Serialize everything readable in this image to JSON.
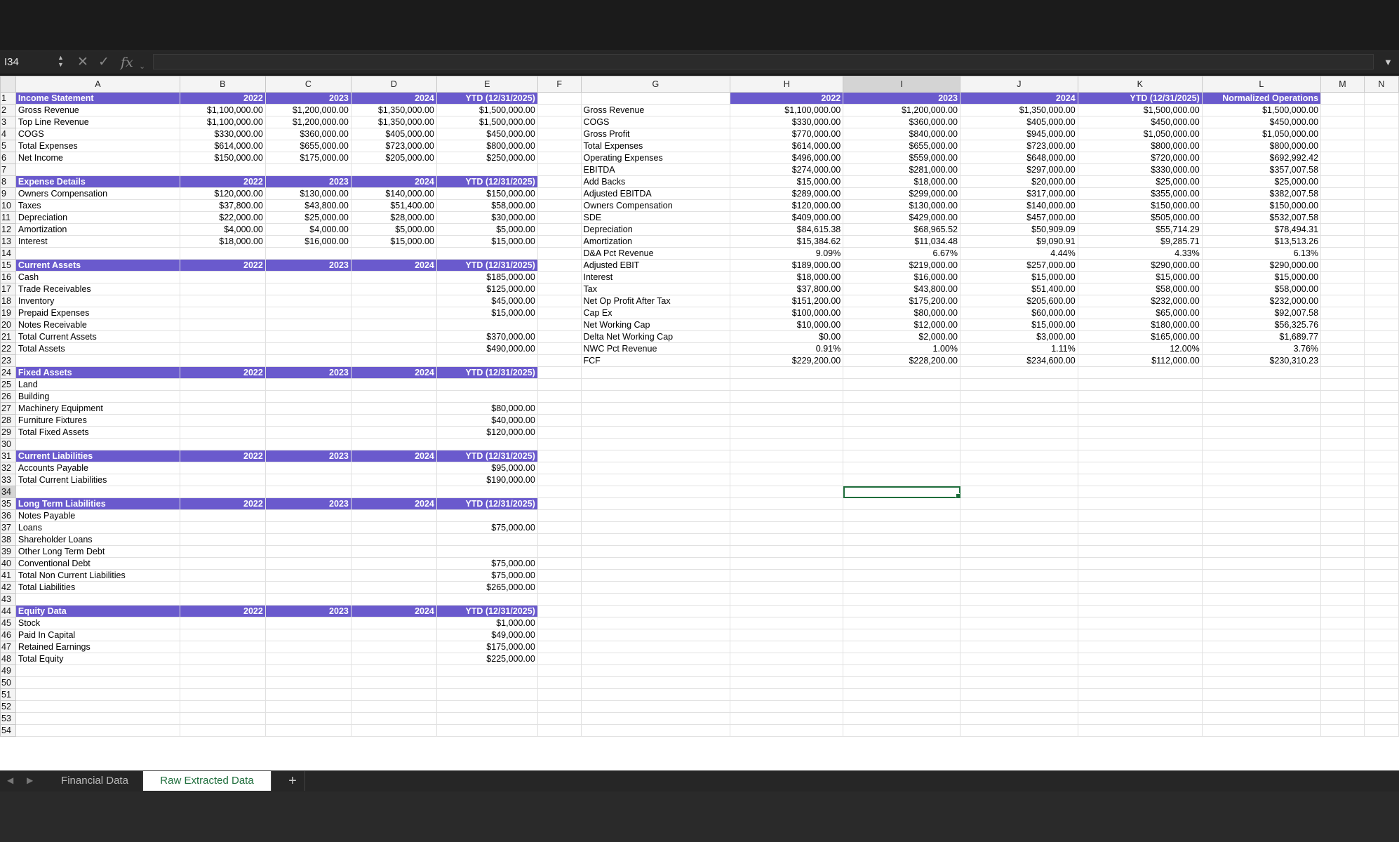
{
  "formula_bar": {
    "name_box": "I34",
    "formula": ""
  },
  "columns": [
    "",
    "A",
    "B",
    "C",
    "D",
    "E",
    "F",
    "G",
    "H",
    "I",
    "J",
    "K",
    "L",
    "M",
    "N"
  ],
  "selected_cell": {
    "row": 34,
    "col": "I"
  },
  "header_rows": [
    1,
    8,
    15,
    24,
    31,
    35,
    44
  ],
  "rows": [
    {
      "n": 1,
      "A": "Income Statement",
      "B": "2022",
      "C": "2023",
      "D": "2024",
      "E": "YTD (12/31/2025)",
      "G": "",
      "H": "2022",
      "I": "2023",
      "J": "2024",
      "K": "YTD (12/31/2025)",
      "L": "Normalized Operations"
    },
    {
      "n": 2,
      "A": "Gross Revenue",
      "B": "$1,100,000.00",
      "C": "$1,200,000.00",
      "D": "$1,350,000.00",
      "E": "$1,500,000.00",
      "G": "Gross Revenue",
      "H": "$1,100,000.00",
      "I": "$1,200,000.00",
      "J": "$1,350,000.00",
      "K": "$1,500,000.00",
      "L": "$1,500,000.00"
    },
    {
      "n": 3,
      "A": "Top Line Revenue",
      "B": "$1,100,000.00",
      "C": "$1,200,000.00",
      "D": "$1,350,000.00",
      "E": "$1,500,000.00",
      "G": "COGS",
      "H": "$330,000.00",
      "I": "$360,000.00",
      "J": "$405,000.00",
      "K": "$450,000.00",
      "L": "$450,000.00"
    },
    {
      "n": 4,
      "A": "COGS",
      "B": "$330,000.00",
      "C": "$360,000.00",
      "D": "$405,000.00",
      "E": "$450,000.00",
      "G": "Gross Profit",
      "H": "$770,000.00",
      "I": "$840,000.00",
      "J": "$945,000.00",
      "K": "$1,050,000.00",
      "L": "$1,050,000.00"
    },
    {
      "n": 5,
      "A": "Total Expenses",
      "B": "$614,000.00",
      "C": "$655,000.00",
      "D": "$723,000.00",
      "E": "$800,000.00",
      "G": "Total Expenses",
      "H": "$614,000.00",
      "I": "$655,000.00",
      "J": "$723,000.00",
      "K": "$800,000.00",
      "L": "$800,000.00"
    },
    {
      "n": 6,
      "A": "Net Income",
      "B": "$150,000.00",
      "C": "$175,000.00",
      "D": "$205,000.00",
      "E": "$250,000.00",
      "G": "Operating Expenses",
      "H": "$496,000.00",
      "I": "$559,000.00",
      "J": "$648,000.00",
      "K": "$720,000.00",
      "L": "$692,992.42"
    },
    {
      "n": 7,
      "G": "EBITDA",
      "H": "$274,000.00",
      "I": "$281,000.00",
      "J": "$297,000.00",
      "K": "$330,000.00",
      "L": "$357,007.58"
    },
    {
      "n": 8,
      "A": "Expense Details",
      "B": "2022",
      "C": "2023",
      "D": "2024",
      "E": "YTD (12/31/2025)",
      "G": "Add Backs",
      "H": "$15,000.00",
      "I": "$18,000.00",
      "J": "$20,000.00",
      "K": "$25,000.00",
      "L": "$25,000.00"
    },
    {
      "n": 9,
      "A": "Owners Compensation",
      "B": "$120,000.00",
      "C": "$130,000.00",
      "D": "$140,000.00",
      "E": "$150,000.00",
      "G": "Adjusted EBITDA",
      "H": "$289,000.00",
      "I": "$299,000.00",
      "J": "$317,000.00",
      "K": "$355,000.00",
      "L": "$382,007.58"
    },
    {
      "n": 10,
      "A": "Taxes",
      "B": "$37,800.00",
      "C": "$43,800.00",
      "D": "$51,400.00",
      "E": "$58,000.00",
      "G": "Owners Compensation",
      "H": "$120,000.00",
      "I": "$130,000.00",
      "J": "$140,000.00",
      "K": "$150,000.00",
      "L": "$150,000.00"
    },
    {
      "n": 11,
      "A": "Depreciation",
      "B": "$22,000.00",
      "C": "$25,000.00",
      "D": "$28,000.00",
      "E": "$30,000.00",
      "G": "SDE",
      "H": "$409,000.00",
      "I": "$429,000.00",
      "J": "$457,000.00",
      "K": "$505,000.00",
      "L": "$532,007.58"
    },
    {
      "n": 12,
      "A": "Amortization",
      "B": "$4,000.00",
      "C": "$4,000.00",
      "D": "$5,000.00",
      "E": "$5,000.00",
      "G": "Depreciation",
      "H": "$84,615.38",
      "I": "$68,965.52",
      "J": "$50,909.09",
      "K": "$55,714.29",
      "L": "$78,494.31"
    },
    {
      "n": 13,
      "A": "Interest",
      "B": "$18,000.00",
      "C": "$16,000.00",
      "D": "$15,000.00",
      "E": "$15,000.00",
      "G": "Amortization",
      "H": "$15,384.62",
      "I": "$11,034.48",
      "J": "$9,090.91",
      "K": "$9,285.71",
      "L": "$13,513.26"
    },
    {
      "n": 14,
      "G": "D&A Pct Revenue",
      "H": "9.09%",
      "I": "6.67%",
      "J": "4.44%",
      "K": "4.33%",
      "L": "6.13%"
    },
    {
      "n": 15,
      "A": "Current Assets",
      "B": "2022",
      "C": "2023",
      "D": "2024",
      "E": "YTD (12/31/2025)",
      "G": "Adjusted EBIT",
      "H": "$189,000.00",
      "I": "$219,000.00",
      "J": "$257,000.00",
      "K": "$290,000.00",
      "L": "$290,000.00"
    },
    {
      "n": 16,
      "A": "Cash",
      "E": "$185,000.00",
      "G": "Interest",
      "H": "$18,000.00",
      "I": "$16,000.00",
      "J": "$15,000.00",
      "K": "$15,000.00",
      "L": "$15,000.00"
    },
    {
      "n": 17,
      "A": "Trade Receivables",
      "E": "$125,000.00",
      "G": "Tax",
      "H": "$37,800.00",
      "I": "$43,800.00",
      "J": "$51,400.00",
      "K": "$58,000.00",
      "L": "$58,000.00"
    },
    {
      "n": 18,
      "A": "Inventory",
      "E": "$45,000.00",
      "G": "Net Op Profit After Tax",
      "H": "$151,200.00",
      "I": "$175,200.00",
      "J": "$205,600.00",
      "K": "$232,000.00",
      "L": "$232,000.00"
    },
    {
      "n": 19,
      "A": "Prepaid Expenses",
      "E": "$15,000.00",
      "G": "Cap Ex",
      "H": "$100,000.00",
      "I": "$80,000.00",
      "J": "$60,000.00",
      "K": "$65,000.00",
      "L": "$92,007.58"
    },
    {
      "n": 20,
      "A": "Notes Receivable",
      "G": "Net Working Cap",
      "H": "$10,000.00",
      "I": "$12,000.00",
      "J": "$15,000.00",
      "K": "$180,000.00",
      "L": "$56,325.76"
    },
    {
      "n": 21,
      "A": "Total Current Assets",
      "E": "$370,000.00",
      "G": "Delta Net Working Cap",
      "H": "$0.00",
      "I": "$2,000.00",
      "J": "$3,000.00",
      "K": "$165,000.00",
      "L": "$1,689.77"
    },
    {
      "n": 22,
      "A": "Total Assets",
      "E": "$490,000.00",
      "G": "NWC Pct Revenue",
      "H": "0.91%",
      "I": "1.00%",
      "J": "1.11%",
      "K": "12.00%",
      "L": "3.76%"
    },
    {
      "n": 23,
      "G": "FCF",
      "H": "$229,200.00",
      "I": "$228,200.00",
      "J": "$234,600.00",
      "K": "$112,000.00",
      "L": "$230,310.23"
    },
    {
      "n": 24,
      "A": "Fixed Assets",
      "B": "2022",
      "C": "2023",
      "D": "2024",
      "E": "YTD (12/31/2025)"
    },
    {
      "n": 25,
      "A": "Land"
    },
    {
      "n": 26,
      "A": "Building"
    },
    {
      "n": 27,
      "A": "Machinery Equipment",
      "E": "$80,000.00"
    },
    {
      "n": 28,
      "A": "Furniture Fixtures",
      "E": "$40,000.00"
    },
    {
      "n": 29,
      "A": "Total Fixed Assets",
      "E": "$120,000.00"
    },
    {
      "n": 30
    },
    {
      "n": 31,
      "A": "Current Liabilities",
      "B": "2022",
      "C": "2023",
      "D": "2024",
      "E": "YTD (12/31/2025)"
    },
    {
      "n": 32,
      "A": "Accounts Payable",
      "E": "$95,000.00"
    },
    {
      "n": 33,
      "A": "Total Current Liabilities",
      "E": "$190,000.00"
    },
    {
      "n": 34
    },
    {
      "n": 35,
      "A": "Long Term Liabilities",
      "B": "2022",
      "C": "2023",
      "D": "2024",
      "E": "YTD (12/31/2025)"
    },
    {
      "n": 36,
      "A": "Notes Payable"
    },
    {
      "n": 37,
      "A": "Loans",
      "E": "$75,000.00"
    },
    {
      "n": 38,
      "A": "Shareholder Loans"
    },
    {
      "n": 39,
      "A": "Other Long Term Debt"
    },
    {
      "n": 40,
      "A": "Conventional Debt",
      "E": "$75,000.00"
    },
    {
      "n": 41,
      "A": "Total Non Current Liabilities",
      "E": "$75,000.00"
    },
    {
      "n": 42,
      "A": "Total Liabilities",
      "E": "$265,000.00"
    },
    {
      "n": 43
    },
    {
      "n": 44,
      "A": "Equity Data",
      "B": "2022",
      "C": "2023",
      "D": "2024",
      "E": "YTD (12/31/2025)"
    },
    {
      "n": 45,
      "A": "Stock",
      "E": "$1,000.00"
    },
    {
      "n": 46,
      "A": "Paid In Capital",
      "E": "$49,000.00"
    },
    {
      "n": 47,
      "A": "Retained Earnings",
      "E": "$175,000.00"
    },
    {
      "n": 48,
      "A": "Total Equity",
      "E": "$225,000.00"
    },
    {
      "n": 49
    },
    {
      "n": 50
    },
    {
      "n": 51
    },
    {
      "n": 52
    },
    {
      "n": 53
    },
    {
      "n": 54
    }
  ],
  "sheet_tabs": [
    {
      "label": "Financial Data",
      "active": false
    },
    {
      "label": "Raw Extracted Data",
      "active": true
    }
  ],
  "add_sheet_label": "+"
}
